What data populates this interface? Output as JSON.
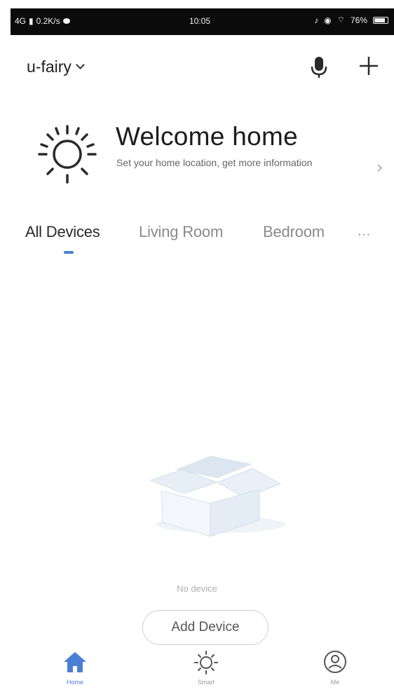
{
  "status_bar": {
    "network": "4G",
    "speed": "0.2K/s",
    "time": "10:05",
    "battery": "76%"
  },
  "header": {
    "home_name": "u-fairy",
    "icons": [
      "chevron-down-icon",
      "microphone-icon",
      "plus-icon"
    ]
  },
  "welcome": {
    "title": "Welcome home",
    "subtitle": "Set your home location, get more information",
    "icon": "sun-icon"
  },
  "tabs": {
    "items": [
      {
        "label": "All Devices",
        "active": true
      },
      {
        "label": "Living Room",
        "active": false
      },
      {
        "label": "Bedroom",
        "active": false
      }
    ],
    "more": "···"
  },
  "empty_state": {
    "message": "No device",
    "button_label": "Add Device",
    "icon": "empty-box-icon"
  },
  "bottom_nav": {
    "items": [
      {
        "label": "Home",
        "icon": "home-icon",
        "active": true
      },
      {
        "label": "Smart",
        "icon": "sun-icon",
        "active": false
      },
      {
        "label": "Me",
        "icon": "user-icon",
        "active": false
      }
    ]
  },
  "colors": {
    "accent": "#4a7fd6",
    "status_bar_bg": "#0b0b0b"
  }
}
